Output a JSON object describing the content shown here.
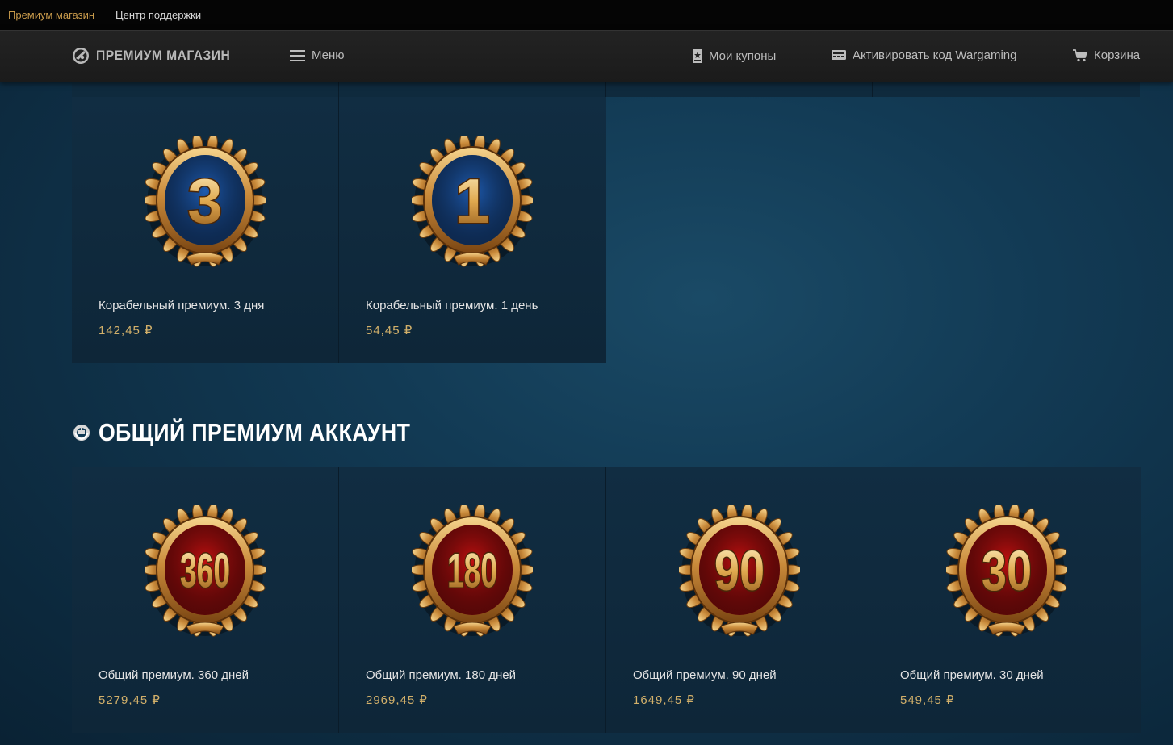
{
  "topbar": {
    "premium_shop": "Премиум магазин",
    "support_center": "Центр поддержки"
  },
  "header": {
    "logo_text": "ПРЕМИУМ МАГАЗИН",
    "menu_label": "Меню",
    "coupons_label": "Мои купоны",
    "activate_label": "Активировать код Wargaming",
    "cart_label": "Корзина"
  },
  "ship_premium": {
    "items": [
      {
        "badge_number": "3",
        "title": "Корабельный премиум. 3 дня",
        "price": "142,45 ₽",
        "badge_color": "#1e5bb0"
      },
      {
        "badge_number": "1",
        "title": "Корабельный премиум. 1 день",
        "price": "54,45 ₽",
        "badge_color": "#1e5bb0"
      }
    ]
  },
  "general_premium": {
    "section_title": "ОБЩИЙ ПРЕМИУМ АККАУНТ",
    "items": [
      {
        "badge_number": "360",
        "title": "Общий премиум. 360 дней",
        "price": "5279,45 ₽",
        "badge_color": "#c01010"
      },
      {
        "badge_number": "180",
        "title": "Общий премиум. 180 дней",
        "price": "2969,45 ₽",
        "badge_color": "#c01010"
      },
      {
        "badge_number": "90",
        "title": "Общий премиум. 90 дней",
        "price": "1649,45 ₽",
        "badge_color": "#c01010"
      },
      {
        "badge_number": "30",
        "title": "Общий премиум. 30 дней",
        "price": "549,45 ₽",
        "badge_color": "#c01010"
      }
    ]
  },
  "colors": {
    "accent_gold": "#c89a4b",
    "price_gold": "#d2b06a",
    "background": "#123a54"
  }
}
